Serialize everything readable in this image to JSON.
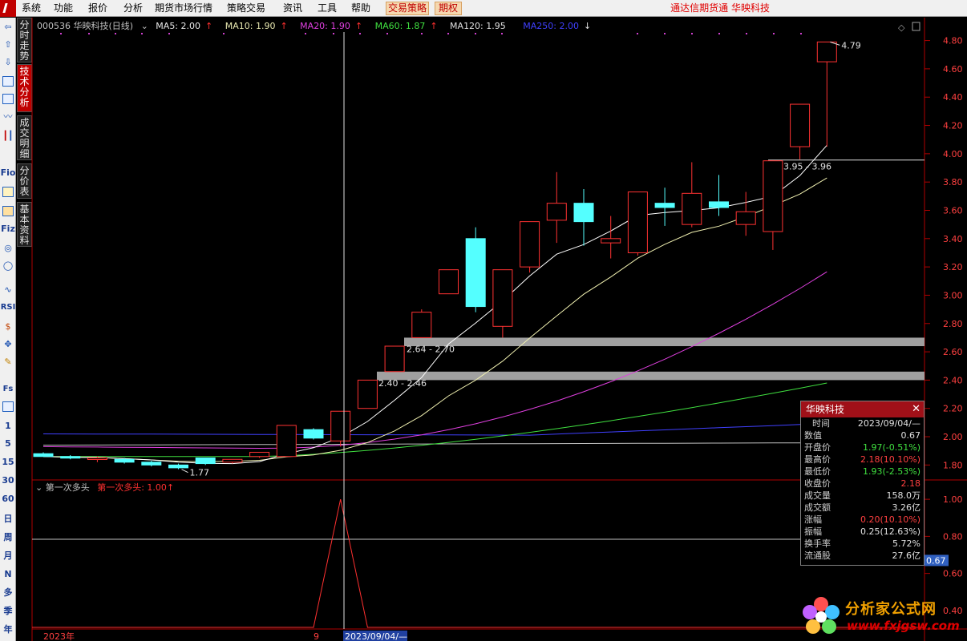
{
  "menubar": {
    "items": [
      "系统",
      "功能",
      "报价",
      "分析",
      "期货市场行情",
      "策略交易",
      "资讯",
      "工具",
      "帮助",
      "交易策略",
      "期权"
    ],
    "title": "通达信期货通  华映科技"
  },
  "vtabs": [
    "分时走势",
    "技术分析",
    "成交明细",
    "分价表",
    "基本资料"
  ],
  "lefttool": {
    "icons": [
      "back-arrow-icon",
      "up-arrow-icon",
      "down-arrow-icon",
      "quote-list-icon",
      "table-icon",
      "line-chart-icon",
      "kline-icon",
      "f10-icon",
      "report-icon",
      "notebook-icon",
      "fiz-icon",
      "gauge-icon",
      "circle-icon",
      "wave-icon"
    ],
    "labels": {
      "fio": "Fio",
      "fiz": "Fiz",
      "rsi": "RSI",
      "fs": "Fs"
    },
    "periods": [
      "1",
      "5",
      "15",
      "30",
      "60",
      "日",
      "周",
      "月",
      "N",
      "多",
      "季",
      "年"
    ]
  },
  "legend": {
    "code_name": "000536 华映科技(日线)",
    "items": [
      {
        "label": "MA5: 2.00",
        "arrow": "↑",
        "color": "#e8e8e8"
      },
      {
        "label": "MA10: 1.90",
        "arrow": "↑",
        "color": "#e8e8b0"
      },
      {
        "label": "MA20: 1.90",
        "arrow": "↑",
        "color": "#e040e0"
      },
      {
        "label": "MA60: 1.87",
        "arrow": "↑",
        "color": "#40e040"
      },
      {
        "label": "MA120: 1.95",
        "arrow": "",
        "color": "#e0e0e0"
      },
      {
        "label": "MA250: 2.00",
        "arrow": "↓",
        "color": "#4040ff"
      }
    ]
  },
  "indicator_legend": {
    "name": "第一次多头",
    "value": "第一次多头: 1.00",
    "arrow": "↑"
  },
  "price_axis": [
    "4.80",
    "4.60",
    "4.40",
    "4.20",
    "4.00",
    "3.80",
    "3.60",
    "3.40",
    "3.20",
    "3.00",
    "2.80",
    "2.60",
    "2.40",
    "2.20",
    "2.00",
    "1.80"
  ],
  "ind_axis": [
    "1.00",
    "0.80",
    "0.60",
    "0.40"
  ],
  "ind_marker": "0.67",
  "time_axis": {
    "year": "2023年",
    "month": "9",
    "cursor": "2023/09/04/—"
  },
  "annotations": {
    "high": "4.79",
    "low": "1.77",
    "zone1": "2.64 - 2.70",
    "zone2": "2.40 - 2.46",
    "zone3": "3.95 - 3.96"
  },
  "chart_data": {
    "type": "candlestick",
    "ylim": [
      1.7,
      4.86
    ],
    "up_color": "#ff3232",
    "down_color": "#54ffff",
    "candles": [
      {
        "o": 1.88,
        "h": 1.89,
        "l": 1.86,
        "c": 1.86
      },
      {
        "o": 1.86,
        "h": 1.87,
        "l": 1.84,
        "c": 1.85
      },
      {
        "o": 1.85,
        "h": 1.86,
        "l": 1.82,
        "c": 1.85
      },
      {
        "o": 1.84,
        "h": 1.85,
        "l": 1.81,
        "c": 1.82
      },
      {
        "o": 1.82,
        "h": 1.83,
        "l": 1.79,
        "c": 1.8
      },
      {
        "o": 1.8,
        "h": 1.81,
        "l": 1.77,
        "c": 1.78
      },
      {
        "o": 1.85,
        "h": 1.85,
        "l": 1.8,
        "c": 1.81
      },
      {
        "o": 1.82,
        "h": 1.84,
        "l": 1.81,
        "c": 1.84
      },
      {
        "o": 1.86,
        "h": 1.89,
        "l": 1.85,
        "c": 1.89
      },
      {
        "o": 1.86,
        "h": 2.08,
        "l": 1.86,
        "c": 2.08
      },
      {
        "o": 2.05,
        "h": 2.06,
        "l": 1.98,
        "c": 1.99
      },
      {
        "o": 1.97,
        "h": 2.18,
        "l": 1.93,
        "c": 2.18
      },
      {
        "o": 2.2,
        "h": 2.4,
        "l": 2.2,
        "c": 2.4
      },
      {
        "o": 2.46,
        "h": 2.64,
        "l": 2.46,
        "c": 2.64
      },
      {
        "o": 2.7,
        "h": 2.9,
        "l": 2.7,
        "c": 2.88
      },
      {
        "o": 3.01,
        "h": 3.18,
        "l": 3.01,
        "c": 3.18
      },
      {
        "o": 3.4,
        "h": 3.48,
        "l": 2.88,
        "c": 2.92
      },
      {
        "o": 2.78,
        "h": 3.18,
        "l": 2.7,
        "c": 3.18
      },
      {
        "o": 3.2,
        "h": 3.52,
        "l": 3.16,
        "c": 3.52
      },
      {
        "o": 3.53,
        "h": 3.87,
        "l": 3.37,
        "c": 3.65
      },
      {
        "o": 3.65,
        "h": 3.75,
        "l": 3.35,
        "c": 3.52
      },
      {
        "o": 3.37,
        "h": 3.56,
        "l": 3.26,
        "c": 3.4
      },
      {
        "o": 3.3,
        "h": 3.73,
        "l": 3.28,
        "c": 3.73
      },
      {
        "o": 3.65,
        "h": 3.76,
        "l": 3.49,
        "c": 3.62
      },
      {
        "o": 3.5,
        "h": 3.94,
        "l": 3.48,
        "c": 3.72
      },
      {
        "o": 3.66,
        "h": 3.85,
        "l": 3.56,
        "c": 3.62
      },
      {
        "o": 3.5,
        "h": 3.73,
        "l": 3.42,
        "c": 3.59
      },
      {
        "o": 3.45,
        "h": 3.95,
        "l": 3.32,
        "c": 3.95
      },
      {
        "o": 4.05,
        "h": 4.35,
        "l": 3.96,
        "c": 4.35
      },
      {
        "o": 4.65,
        "h": 4.79,
        "l": 4.05,
        "c": 4.79
      }
    ],
    "indicator": {
      "name": "第一次多头",
      "ylim": [
        0.3,
        1.1
      ],
      "signal_index": 11
    }
  },
  "info_panel": {
    "title": "华映科技",
    "rows": [
      {
        "k": "时间",
        "v": "2023/09/04/—",
        "color": "#e0e0e0"
      },
      {
        "k": "数值",
        "v": "0.67",
        "color": "#e0e0e0"
      },
      {
        "k": "开盘价",
        "v": "1.97(-0.51%)",
        "color": "#40e040"
      },
      {
        "k": "最高价",
        "v": "2.18(10.10%)",
        "color": "#ff4040"
      },
      {
        "k": "最低价",
        "v": "1.93(-2.53%)",
        "color": "#40e040"
      },
      {
        "k": "收盘价",
        "v": "2.18",
        "color": "#ff4040"
      },
      {
        "k": "成交量",
        "v": "158.0万",
        "color": "#e0e0e0"
      },
      {
        "k": "成交额",
        "v": "3.26亿",
        "color": "#e0e0e0"
      },
      {
        "k": "涨幅",
        "v": "0.20(10.10%)",
        "color": "#ff4040"
      },
      {
        "k": "振幅",
        "v": "0.25(12.63%)",
        "color": "#e0e0e0"
      },
      {
        "k": "换手率",
        "v": "5.72%",
        "color": "#e0e0e0"
      },
      {
        "k": "流通股",
        "v": "27.6亿",
        "color": "#e0e0e0"
      }
    ]
  },
  "watermark": {
    "title": "分析家公式网",
    "url": "www.fxjgsw.com"
  }
}
